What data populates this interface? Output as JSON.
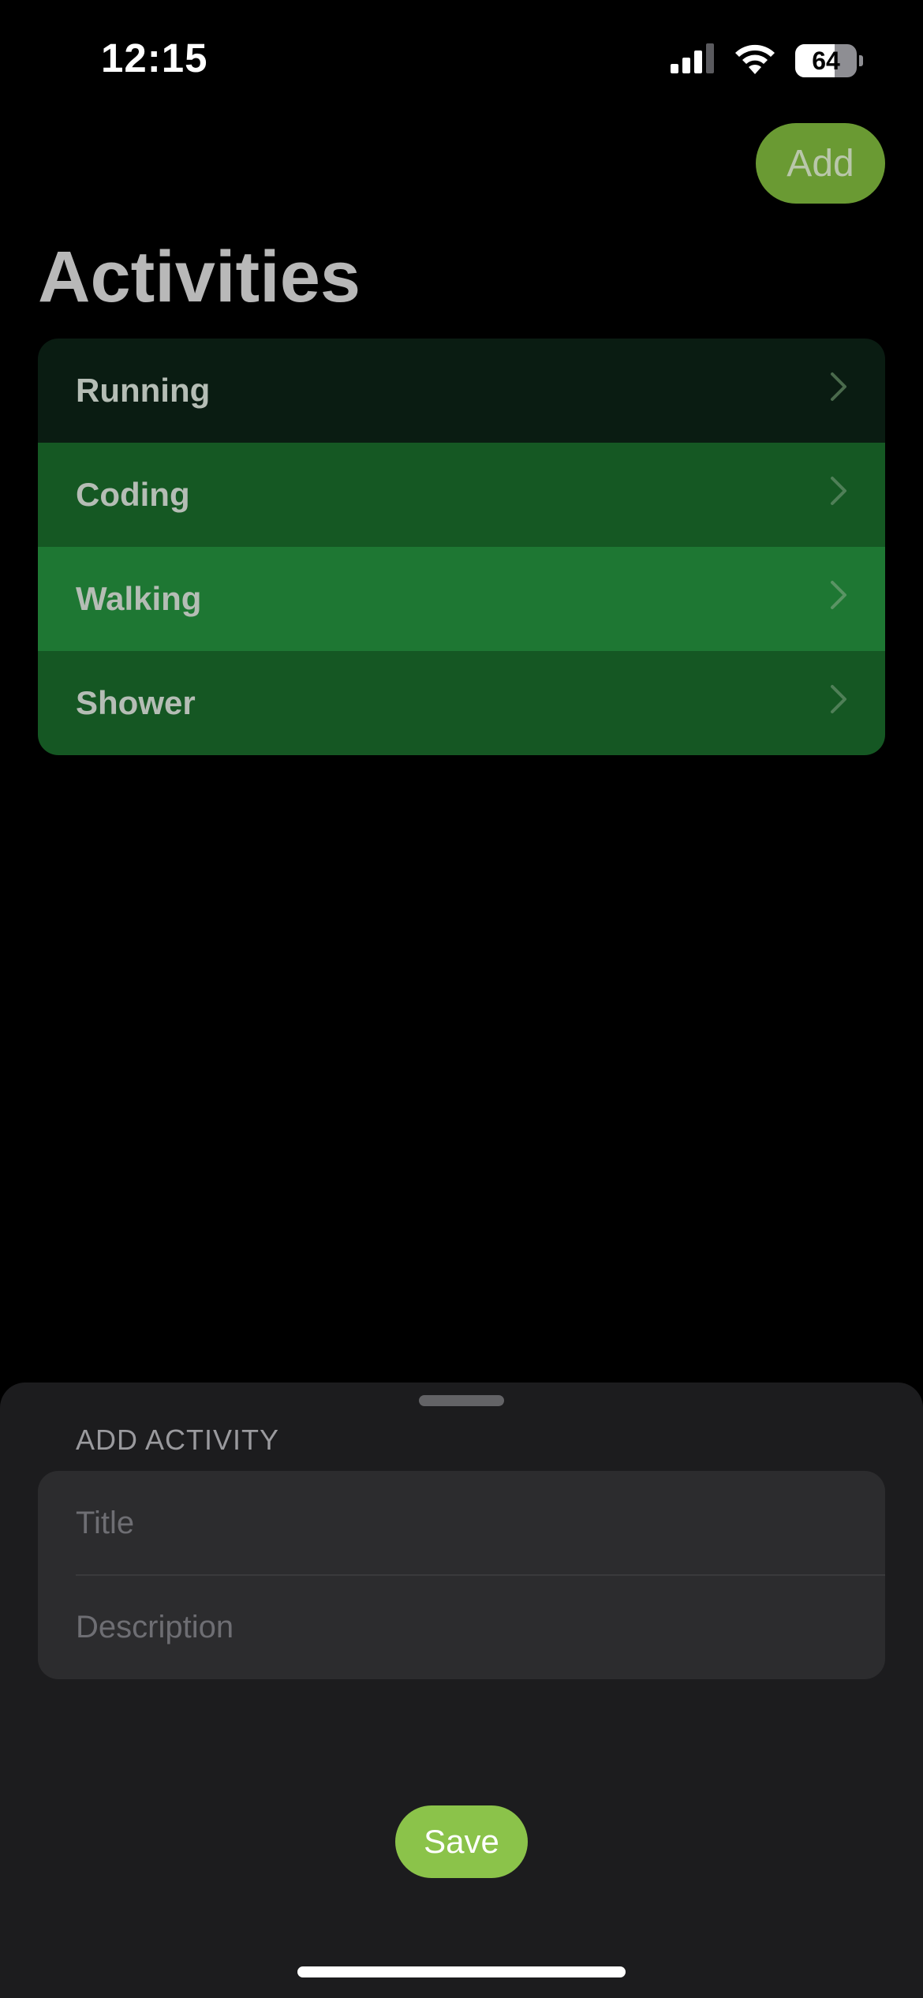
{
  "status_bar": {
    "time": "12:15",
    "battery_level": "64",
    "battery_fraction": 0.64,
    "icons": [
      "cellular-signal-icon",
      "wifi-icon",
      "battery-icon"
    ]
  },
  "header": {
    "add_label": "Add",
    "title": "Activities"
  },
  "activities": [
    {
      "label": "Running",
      "color": "#0a1c12"
    },
    {
      "label": "Coding",
      "color": "#155823"
    },
    {
      "label": "Walking",
      "color": "#1e7733"
    },
    {
      "label": "Shower",
      "color": "#155723"
    }
  ],
  "sheet": {
    "section_header": "ADD ACTIVITY",
    "title_placeholder": "Title",
    "title_value": "",
    "description_placeholder": "Description",
    "description_value": "",
    "save_label": "Save"
  },
  "colors": {
    "accent": "#8bc34a",
    "add_button": "#6a9a33",
    "sheet_background": "#1c1c1e",
    "field_background": "#2c2c2e"
  }
}
